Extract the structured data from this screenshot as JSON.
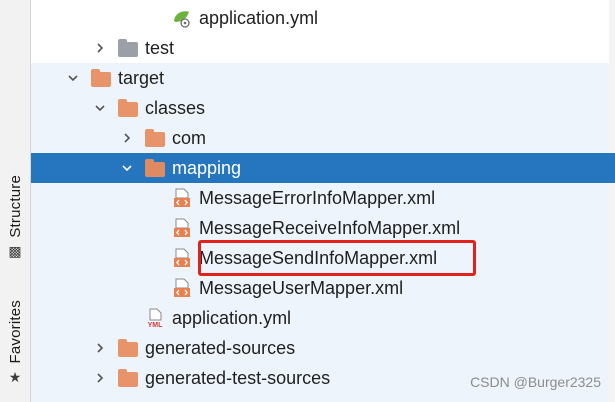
{
  "side_tabs": {
    "structure": "Structure",
    "favorites": "Favorites"
  },
  "tree": {
    "rows": [
      {
        "label": "application.yml",
        "icon": "spring-config-icon",
        "indent": 5,
        "chevron": "none"
      },
      {
        "label": "test",
        "icon": "folder-gray-icon",
        "indent": 3,
        "chevron": "right"
      },
      {
        "label": "target",
        "icon": "folder-orange-icon",
        "indent": 2,
        "chevron": "down"
      },
      {
        "label": "classes",
        "icon": "folder-orange-icon",
        "indent": 3,
        "chevron": "down"
      },
      {
        "label": "com",
        "icon": "folder-orange-icon",
        "indent": 4,
        "chevron": "right"
      },
      {
        "label": "mapping",
        "icon": "folder-orange-icon",
        "indent": 4,
        "chevron": "down",
        "selected": true
      },
      {
        "label": "MessageErrorInfoMapper.xml",
        "icon": "xml-file-icon",
        "indent": 5,
        "chevron": "none"
      },
      {
        "label": "MessageReceiveInfoMapper.xml",
        "icon": "xml-file-icon",
        "indent": 5,
        "chevron": "none"
      },
      {
        "label": "MessageSendInfoMapper.xml",
        "icon": "xml-file-icon",
        "indent": 5,
        "chevron": "none",
        "highlighted": true
      },
      {
        "label": "MessageUserMapper.xml",
        "icon": "xml-file-icon",
        "indent": 5,
        "chevron": "none"
      },
      {
        "label": "application.yml",
        "icon": "yml-file-icon",
        "indent": 4,
        "chevron": "none"
      },
      {
        "label": "generated-sources",
        "icon": "folder-orange-icon",
        "indent": 3,
        "chevron": "right"
      },
      {
        "label": "generated-test-sources",
        "icon": "folder-orange-icon",
        "indent": 3,
        "chevron": "right"
      }
    ]
  },
  "watermark": "CSDN @Burger2325",
  "colors": {
    "selection": "#2675bf",
    "target_background": "#edf4fb",
    "folder_orange": "#e8946b",
    "folder_gray": "#9aa0a6",
    "highlight_border": "#e2211c"
  }
}
